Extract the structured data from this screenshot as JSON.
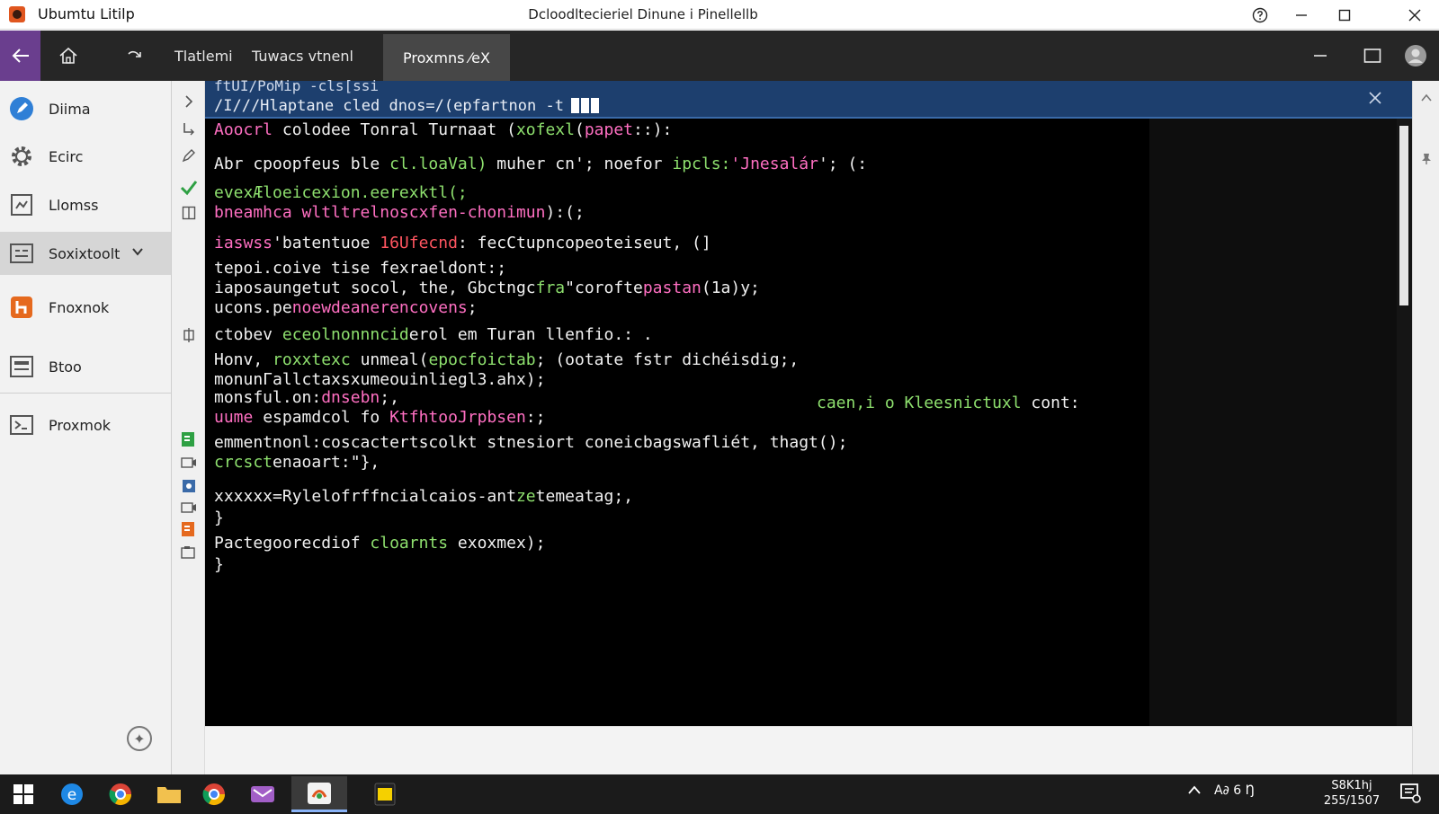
{
  "titlebar": {
    "app_title": "Ubumtu Litilp",
    "window_title": "Dcloodltecieriel Dinune i Pinellellb"
  },
  "toolbar": {
    "tabs": [
      "Tlatlemi",
      "Tuwacs vtnenl"
    ],
    "active_tab": "Proxmns ⁄eX"
  },
  "sidebar": {
    "items": [
      {
        "label": "Diima",
        "icon": "edit-icon"
      },
      {
        "label": "Ecirc",
        "icon": "gear-icon"
      },
      {
        "label": "Llomss",
        "icon": "image-icon"
      },
      {
        "label": "Soxixtoolt",
        "icon": "terminal-icon"
      },
      {
        "label": "Fnoxnok",
        "icon": "app-icon"
      },
      {
        "label": "Btoo",
        "icon": "monitor-icon"
      },
      {
        "label": "Proxmok",
        "icon": "console-icon"
      }
    ]
  },
  "panel": {
    "header_line1": "ftUI/PoMip  -cls[ssi",
    "header_line2": "/I///Hlaptane cled dnos=/(epfartnon -t"
  },
  "terminal": {
    "lines": [
      [
        {
          "t": "Aoocrl ",
          "c": "c-pink"
        },
        {
          "t": "colodee Tonral Turnaat (",
          "c": "c-white"
        },
        {
          "t": "xofexl",
          "c": "c-green"
        },
        {
          "t": "(",
          "c": "c-white"
        },
        {
          "t": "papet",
          "c": "c-pink"
        },
        {
          "t": "::):",
          "c": "c-white"
        }
      ],
      [
        {
          "t": "Abr cpoopfeus ble ",
          "c": "c-white"
        },
        {
          "t": "cl.loaVal)",
          "c": "c-green"
        },
        {
          "t": " muher cn'; noefor ",
          "c": "c-white"
        },
        {
          "t": "ipcls:",
          "c": "c-green"
        },
        {
          "t": "'Jnesalár",
          "c": "c-pink"
        },
        {
          "t": "'; (:",
          "c": "c-white"
        }
      ],
      [
        {
          "t": "evexÆloeicexion.eerexktl(;",
          "c": "c-green"
        }
      ],
      [
        {
          "t": "bneamhca wltltrelnoscxfen-chonimun",
          "c": "c-pink"
        },
        {
          "t": "):(;",
          "c": "c-white"
        }
      ],
      [
        {
          "t": "iaswss",
          "c": "c-pink"
        },
        {
          "t": "'batentuoe ",
          "c": "c-white"
        },
        {
          "t": "16Ufecnd",
          "c": "c-red"
        },
        {
          "t": ": fecCtupncopeoteiseut, (]",
          "c": "c-white"
        }
      ],
      [
        {
          "t": "tepoi.coive tise fexraeldont:;",
          "c": "c-white"
        }
      ],
      [
        {
          "t": "iaposaungetut socol, the, Gbctngc",
          "c": "c-white"
        },
        {
          "t": "fra",
          "c": "c-green"
        },
        {
          "t": "\"corofte",
          "c": "c-white"
        },
        {
          "t": "pastan",
          "c": "c-pink"
        },
        {
          "t": "(1a)y;",
          "c": "c-white"
        }
      ],
      [
        {
          "t": "ucons.pe",
          "c": "c-white"
        },
        {
          "t": "noewdeanerencovens",
          "c": "c-pink"
        },
        {
          "t": ";",
          "c": "c-white"
        }
      ],
      [
        {
          "t": "ctobev ",
          "c": "c-white"
        },
        {
          "t": "eceolnonnncid",
          "c": "c-green"
        },
        {
          "t": "erol em Turan llenfio.: .",
          "c": "c-white"
        }
      ],
      [
        {
          "t": "Honv, ",
          "c": "c-white"
        },
        {
          "t": "roxxtexc",
          "c": "c-green"
        },
        {
          "t": " unmeal(",
          "c": "c-white"
        },
        {
          "t": "epocfoictab",
          "c": "c-green"
        },
        {
          "t": "; (ootate fstr dichéisdig;,",
          "c": "c-white"
        }
      ],
      [
        {
          "t": "monunΓallctaxsxumeouinliegl3.ahx);",
          "c": "c-white"
        }
      ],
      [
        {
          "t": "monsful.on:",
          "c": "c-white"
        },
        {
          "t": "dnsebn",
          "c": "c-pink"
        },
        {
          "t": ";,",
          "c": "c-white"
        }
      ],
      [
        {
          "t": "uume",
          "c": "c-pink"
        },
        {
          "t": " espamdcol fo ",
          "c": "c-white"
        },
        {
          "t": "Ktfhtoo",
          "c": "c-pink"
        },
        {
          "t": "Jrpbsen",
          "c": "c-pink"
        },
        {
          "t": ":;",
          "c": "c-white"
        }
      ],
      [
        {
          "t": "       emmentnonl:coscactertscolkt stnesiort coneicbagswafliét, thagt();",
          "c": "c-white"
        }
      ],
      [
        {
          "t": "crcsct",
          "c": "c-green"
        },
        {
          "t": "enaoart:\"},",
          "c": "c-white"
        }
      ],
      [
        {
          "t": "xxxxxx=Rylelofrffncialcaios-ant",
          "c": "c-white"
        },
        {
          "t": "ze",
          "c": "c-green"
        },
        {
          "t": "temeatag;,",
          "c": "c-white"
        }
      ],
      [
        {
          "t": "}",
          "c": "c-white"
        }
      ],
      [
        {
          "t": "Pactegoorecdiof ",
          "c": "c-white"
        },
        {
          "t": "cloarnts",
          "c": "c-green"
        },
        {
          "t": " exoxmex);",
          "c": "c-white"
        }
      ],
      [
        {
          "t": "}",
          "c": "c-white"
        }
      ]
    ],
    "side_note": [
      {
        "t": "caen,i o ",
        "c": "c-green"
      },
      {
        "t": "Kleesnictuxl",
        "c": "c-green"
      },
      {
        "t": " cont:",
        "c": "c-white"
      }
    ]
  },
  "taskbar": {
    "tray_text": "A∂ 6 Ŋ",
    "clock_time": "S8K1hj",
    "clock_date": "255/1507"
  },
  "colors": {
    "accent_purple": "#6a3e8e",
    "panel_header_blue": "#1d3f6e",
    "terminal_bg": "#000000"
  }
}
